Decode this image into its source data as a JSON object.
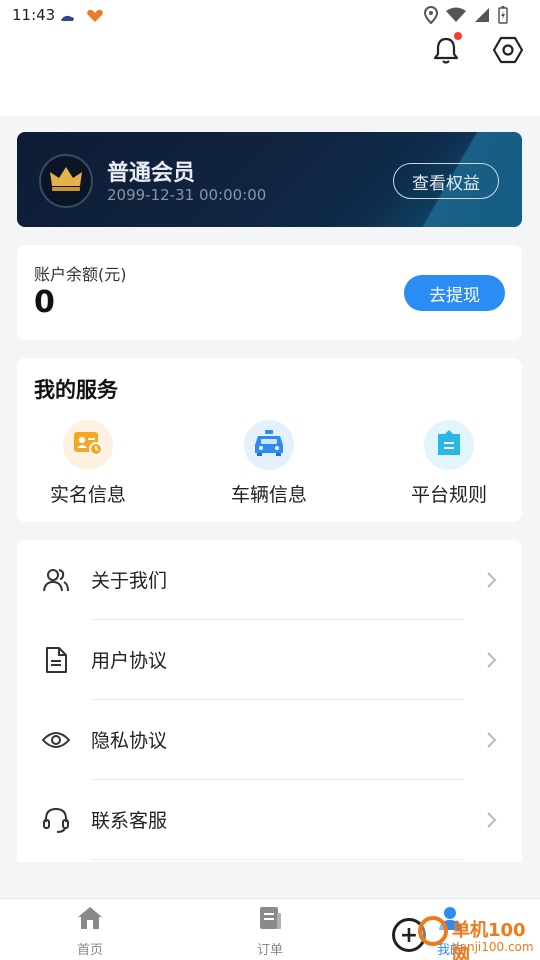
{
  "status_bar": {
    "time": "11:43"
  },
  "header": {
    "bell_icon": "bell-icon",
    "settings_icon": "settings-icon"
  },
  "membership": {
    "level": "普通会员",
    "expiry": "2099-12-31 00:00:00",
    "benefits_button": "查看权益",
    "icon": "crown-icon"
  },
  "balance": {
    "label": "账户余额(元)",
    "value": "0",
    "withdraw_button": "去提现"
  },
  "services": {
    "title": "我的服务",
    "items": [
      {
        "label": "实名信息",
        "icon": "id-card-icon",
        "color": "#f5a623"
      },
      {
        "label": "车辆信息",
        "icon": "car-icon",
        "color": "#2b8cf3"
      },
      {
        "label": "平台规则",
        "icon": "rules-icon",
        "color": "#28b7e8"
      }
    ]
  },
  "menu": [
    {
      "label": "关于我们",
      "icon": "users-icon"
    },
    {
      "label": "用户协议",
      "icon": "document-icon"
    },
    {
      "label": "隐私协议",
      "icon": "eye-icon"
    },
    {
      "label": "联系客服",
      "icon": "headset-icon"
    }
  ],
  "bottom_nav": [
    {
      "label": "首页",
      "icon": "home-icon"
    },
    {
      "label": "订单",
      "icon": "orders-icon"
    },
    {
      "label": "我的",
      "icon": "profile-icon",
      "active": true
    }
  ],
  "watermark": {
    "text": "单机100网",
    "url": "danji100.com"
  },
  "colors": {
    "accent": "#2b8cf3",
    "card_dark": "#0e1c34",
    "notification_dot": "#ff3b30"
  }
}
